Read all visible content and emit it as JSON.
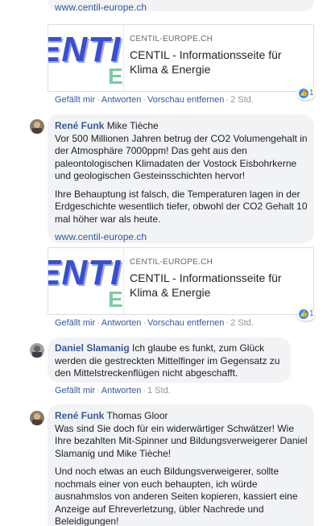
{
  "colors": {
    "link": "#385898",
    "bubble": "#f2f3f5",
    "like_blue": "#2e89ff"
  },
  "top_link": "www.centil-europe.ch",
  "comments": [
    {
      "preview": {
        "domain": "CENTIL-EUROPE.CH",
        "title": "CENTIL - Informationsseite für Klima & Energie",
        "logo_text": "ENTI",
        "logo_small": "E"
      },
      "reactions": {
        "count": "1",
        "icon": "like-icon"
      },
      "actions": {
        "like": "Gefällt mir",
        "reply": "Antworten",
        "remove_preview": "Vorschau entfernen",
        "time": "2 Std."
      }
    },
    {
      "author": "René Funk",
      "mention": "Mike Tièche",
      "paragraphs": [
        "Vor 500 Millionen Jahren betrug der CO2 Volumengehalt in der Atmosphäre 7000ppm! Das geht aus den paleontologischen Klimadaten der Vostock Eisbohrkerne und geologischen Gesteinsschichten hervor!",
        "Ihre Behauptung ist falsch, die Temperaturen lagen in der Erdgeschichte wesentlich tiefer, obwohl der CO2 Gehalt 10 mal höher war als heute."
      ],
      "link": "www.centil-europe.ch",
      "preview": {
        "domain": "CENTIL-EUROPE.CH",
        "title": "CENTIL - Informationsseite für Klima & Energie",
        "logo_text": "ENTI",
        "logo_small": "E"
      },
      "reactions": {
        "count": "1",
        "icon": "like-icon"
      },
      "actions": {
        "like": "Gefällt mir",
        "reply": "Antworten",
        "remove_preview": "Vorschau entfernen",
        "time": "2 Std."
      }
    },
    {
      "author": "Daniel Slamanig",
      "text": "Ich glaube es funkt, zum Glück werden die gestreckten Mittelfinger im Gegensatz zu den Mittelstreckenflügen nicht abgeschafft.",
      "actions": {
        "like": "Gefällt mir",
        "reply": "Antworten",
        "time": "1 Std."
      }
    },
    {
      "author": "René Funk",
      "mention": "Thomas Gloor",
      "paragraphs": [
        "Was sind Sie doch für ein widerwärtiger Schwätzer! Wie Ihre bezahlten Mit-Spinner und Bildungsverweigerer Daniel Slamanig und Mike Tièche!",
        "Und noch etwas an euch Bildungsverweigerer, sollte nochmals einer von euch behaupten, ich würde ausnahmslos von anderen Seiten kopieren, kassiert eine Anzeige auf Ehreverletzung, übler Nachrede und Beleidigungen!"
      ]
    }
  ]
}
